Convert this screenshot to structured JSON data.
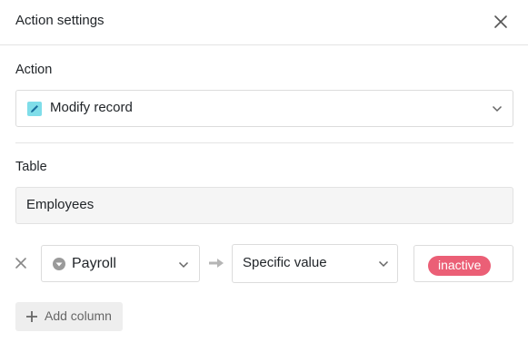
{
  "dialog": {
    "title": "Action settings"
  },
  "action": {
    "label": "Action",
    "value": "Modify record"
  },
  "table": {
    "label": "Table",
    "value": "Employees"
  },
  "mapping": {
    "column": "Payroll",
    "value_type": "Specific value",
    "value_tag": "inactive"
  },
  "add_column_label": "Add column",
  "colors": {
    "tag_bg": "#eb5f76",
    "action_icon": "#7fdde9",
    "border": "#dcdcdc"
  }
}
